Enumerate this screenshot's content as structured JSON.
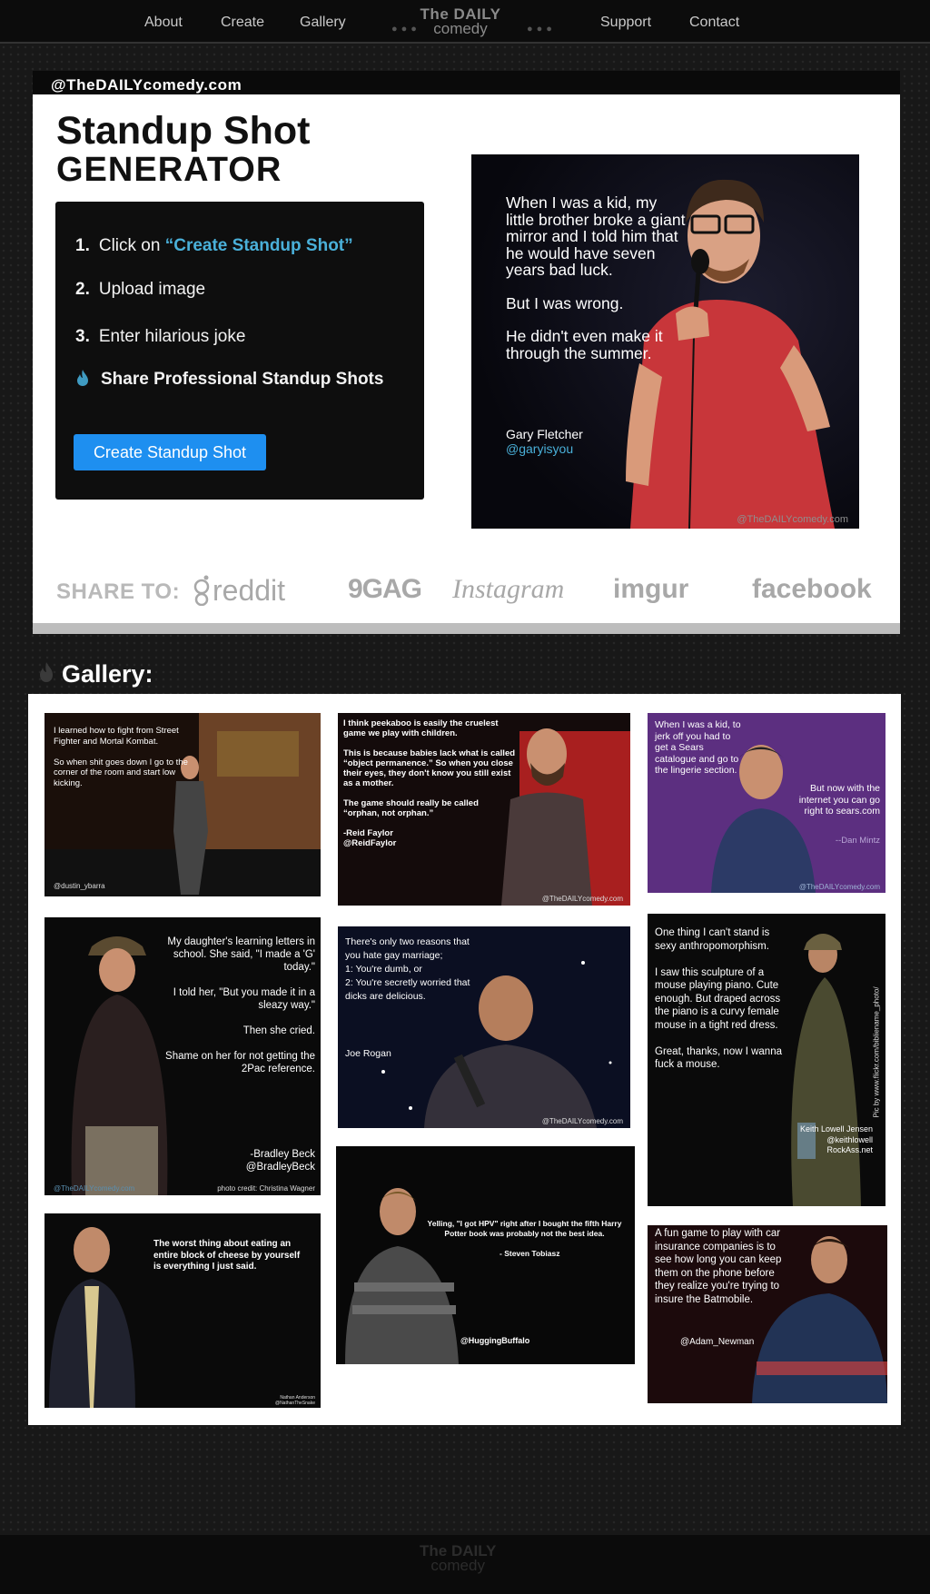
{
  "nav": {
    "items": [
      "About",
      "Create",
      "Gallery",
      "Support",
      "Contact"
    ],
    "logo_line1": "The DAILY",
    "logo_line2": "comedy"
  },
  "hero": {
    "handle": "@TheDAILYcomedy.com",
    "title_line1": "Standup Shot",
    "title_line2": "GENERATOR",
    "steps": [
      {
        "num": "1.",
        "pre": "Click on ",
        "highlight": "“Create Standup Shot”"
      },
      {
        "num": "2.",
        "text": "Upload image"
      },
      {
        "num": "3.",
        "text": "Enter hilarious joke"
      }
    ],
    "share_step": "Share Professional Standup Shots",
    "cta_label": "Create Standup Shot",
    "feature": {
      "joke_p1": "When I was a kid, my little brother broke a giant mirror and I told him that he would have seven years bad luck.",
      "joke_p2": "But I was wrong.",
      "joke_p3": "He didn't even make it through the summer.",
      "comedian": "Gary Fletcher",
      "comedian_handle": "@garyisyou",
      "watermark": "@TheDAILYcomedy.com"
    },
    "share_label": "SHARE TO:",
    "share_targets": [
      "reddit",
      "9GAG",
      "Instagram",
      "imgur",
      "facebook"
    ]
  },
  "gallery": {
    "title": "Gallery:",
    "cards": [
      {
        "text": "I learned how to fight from Street Fighter and Mortal Kombat.\n\nSo when shit goes down I go to the corner of the room and start low kicking.",
        "credit": "@dustin_ybarra"
      },
      {
        "text": "I think peekaboo is easily the cruelest game we play with children.\n\nThis is because babies lack what is called “object permanence.” So when you close their eyes, they don't know you still exist as a mother.\n\nThe game should really be called “orphan, not orphan.”\n\n-Reid Faylor\n@ReidFaylor",
        "credit": "@TheDAILYcomedy.com"
      },
      {
        "text": "When I was a kid, to jerk off you had to get a Sears catalogue and go to the lingerie section.",
        "text2": "But now with the internet you can go right to sears.com",
        "author": "--Dan Mintz",
        "credit": "@TheDAILYcomedy.com"
      },
      {
        "text": "My daughter's learning letters in school.  She said, \"I made a 'G' today.\"\n\nI told her, \"But you made it in a sleazy way.\"\n\nThen she cried.\n\nShame on her for not getting the 2Pac reference.",
        "author": "-Bradley Beck\n@BradleyBeck",
        "credit": "photo credit: Christina Wagner",
        "wm": "@TheDAILYcomedy.com"
      },
      {
        "text": "There's only two reasons that you hate gay marriage;\n1: You're dumb, or\n2: You're secretly worried that dicks are delicious.",
        "author": "Joe Rogan",
        "credit": "@TheDAILYcomedy.com"
      },
      {
        "text": "One thing I can't stand is sexy anthropomorphism.\n\nI saw this sculpture of a mouse playing piano. Cute enough. But draped across the piano is a curvy female mouse in a tight red dress.\n\nGreat, thanks, now I wanna fuck a mouse.",
        "author": "Keith Lowell Jensen\n@keithlowell\nRockAss.net",
        "vertical": "Pic by www.flickr.com/bibliename_photo/"
      },
      {
        "text": "The worst thing about eating an entire block of cheese by yourself is everything I just said.",
        "credit": "Nathan Anderson\n@NathanTheSnake"
      },
      {
        "text": "Yelling, \"I got HPV\" right after I bought the fifth Harry Potter book was probably not the best idea.",
        "author": "- Steven Tobiasz",
        "credit": "@HuggingBuffalo"
      },
      {
        "text": "A fun game to play with car insurance companies is to see how long you can keep them on the phone before they realize you're trying to insure the Batmobile.",
        "author": "@Adam_Newman"
      }
    ]
  },
  "footer": {
    "logo_line1": "The DAILY",
    "logo_line2": "comedy"
  },
  "colors": {
    "accent": "#4ab0d9",
    "button": "#1e8ff0",
    "nav_bg": "#0c0c0c"
  }
}
